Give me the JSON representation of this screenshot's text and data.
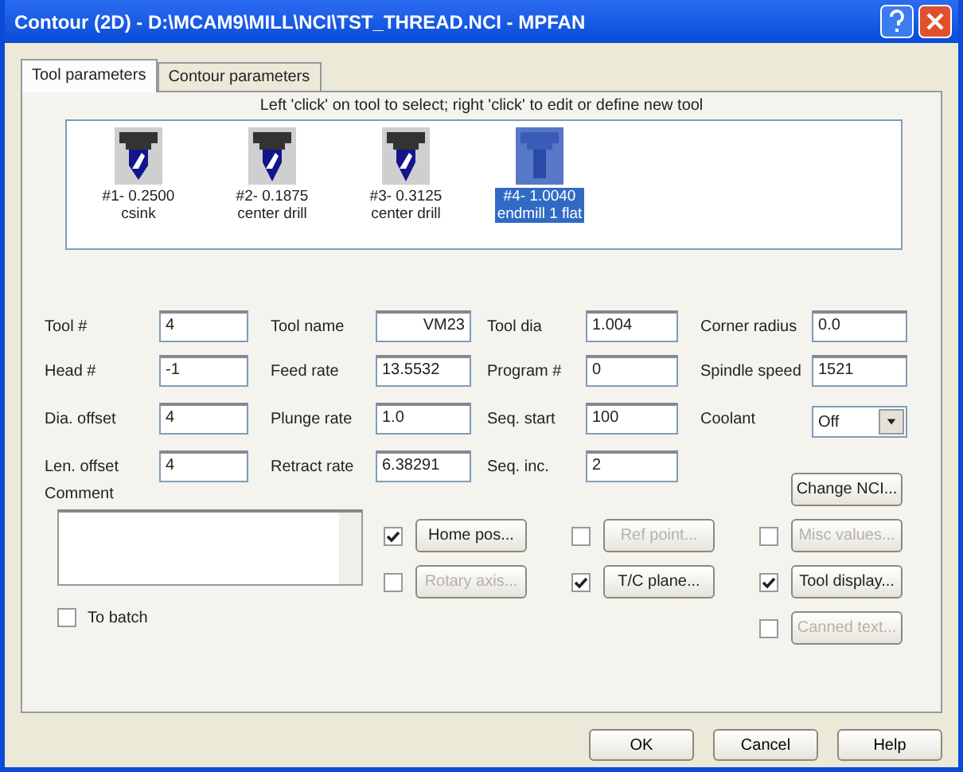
{
  "window": {
    "title": "Contour (2D) - D:\\MCAM9\\MILL\\NCI\\TST_THREAD.NCI - MPFAN"
  },
  "tabs": [
    {
      "label": "Tool parameters",
      "selected": true
    },
    {
      "label": "Contour parameters",
      "selected": false
    }
  ],
  "tool_hint": "Left 'click' on tool to select; right 'click' to edit or define new tool",
  "tools": [
    {
      "kind": "drill",
      "number": "#1- 0.2500",
      "description": "csink",
      "selected": false
    },
    {
      "kind": "center",
      "number": "#2- 0.1875",
      "description": "center drill",
      "selected": false
    },
    {
      "kind": "center",
      "number": "#3- 0.3125",
      "description": "center drill",
      "selected": false
    },
    {
      "kind": "endmill",
      "number": "#4- 1.0040",
      "description": "endmill 1 flat",
      "selected": true
    }
  ],
  "fields": [
    {
      "label": "Tool #",
      "value": "4",
      "kind": "input"
    },
    {
      "label": "Tool name",
      "value": "VM23",
      "kind": "input",
      "right_aligned": true
    },
    {
      "label": "Tool dia",
      "value": "1.004",
      "kind": "input"
    },
    {
      "label": "Corner radius",
      "value": "0.0",
      "kind": "input"
    },
    {
      "label": "Head #",
      "value": "-1",
      "kind": "input"
    },
    {
      "label": "Feed rate",
      "value": "13.5532",
      "kind": "input"
    },
    {
      "label": "Program #",
      "value": "0",
      "kind": "input"
    },
    {
      "label": "Spindle speed",
      "value": "1521",
      "kind": "input"
    },
    {
      "label": "Dia. offset",
      "value": "4",
      "kind": "input"
    },
    {
      "label": "Plunge rate",
      "value": "1.0",
      "kind": "input"
    },
    {
      "label": "Seq. start",
      "value": "100",
      "kind": "input"
    },
    {
      "label": "Coolant",
      "value": "Off",
      "kind": "dropdown"
    },
    {
      "label": "Len. offset",
      "value": "4",
      "kind": "input"
    },
    {
      "label": "Retract rate",
      "value": "6.38291",
      "kind": "input"
    },
    {
      "label": "Seq. inc.",
      "value": "2",
      "kind": "input"
    }
  ],
  "change_nci_button": "Change NCI...",
  "comment": {
    "label": "Comment"
  },
  "to_batch": {
    "label": "To batch",
    "checked": false
  },
  "option_columns": [
    [
      {
        "label": "Home pos...",
        "checked": true,
        "disabled": false
      },
      {
        "label": "Rotary axis...",
        "checked": false,
        "disabled": true
      }
    ],
    [
      {
        "label": "Ref point...",
        "checked": false,
        "disabled": true
      },
      {
        "label": "T/C plane...",
        "checked": true,
        "disabled": false
      }
    ],
    [
      {
        "label": "Misc values...",
        "checked": false,
        "disabled": true
      },
      {
        "label": "Tool display...",
        "checked": true,
        "disabled": false
      },
      {
        "label": "Canned text...",
        "checked": false,
        "disabled": true
      }
    ]
  ],
  "footer_buttons": [
    "OK",
    "Cancel",
    "Help"
  ]
}
